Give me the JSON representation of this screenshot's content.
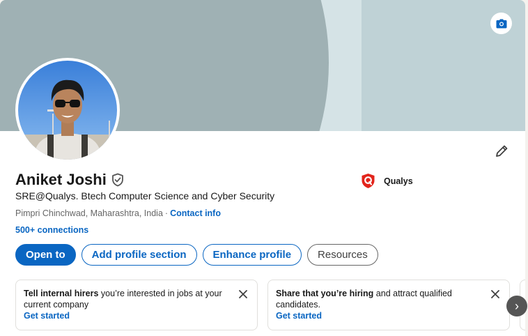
{
  "profile": {
    "name": "Aniket Joshi",
    "headline": "SRE@Qualys. Btech Computer Science and Cyber Security",
    "location": "Pimpri Chinchwad, Maharashtra, India",
    "separator": "·",
    "contact_label": "Contact info",
    "connections": "500+ connections"
  },
  "company": {
    "name": "Qualys",
    "logo_icon": "qualys-logo-icon",
    "logo_color": "#e2241b"
  },
  "actions": {
    "open_to": "Open to",
    "add_section": "Add profile section",
    "enhance": "Enhance profile",
    "resources": "Resources"
  },
  "suggestions": [
    {
      "bold": "Tell internal hirers",
      "rest": " you’re interested in jobs at your current company",
      "link": "Get started"
    },
    {
      "bold": "Share that you’re hiring",
      "rest": " and attract qualified candidates.",
      "link": "Get started"
    }
  ],
  "carousel": {
    "next_glyph": "›"
  },
  "colors": {
    "accent": "#0a66c2",
    "banner_light": "#bfd2d6",
    "banner_dark": "#9fb1b4"
  }
}
